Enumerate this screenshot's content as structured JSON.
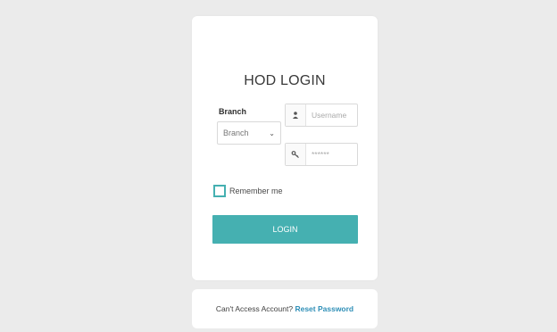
{
  "login": {
    "title": "HOD LOGIN",
    "branch_label": "Branch",
    "branch_value": "Branch",
    "username_placeholder": "Username",
    "password_placeholder": "******",
    "remember_label": "Remember me",
    "login_button": "LOGIN"
  },
  "access": {
    "text": "Can't Access Account?",
    "link": "Reset Password"
  },
  "icons": {
    "user": "user-icon",
    "key": "key-icon",
    "chevron": "chevron-down-icon"
  },
  "colors": {
    "accent": "#45b0b1",
    "link": "#2f8fb7"
  }
}
